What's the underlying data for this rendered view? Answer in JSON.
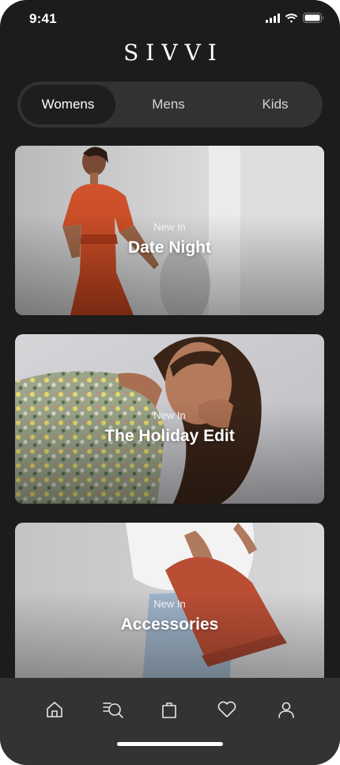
{
  "status_bar": {
    "time": "9:41"
  },
  "brand": {
    "name": "SIVVI"
  },
  "segments": [
    {
      "label": "Womens",
      "selected": true
    },
    {
      "label": "Mens",
      "selected": false
    },
    {
      "label": "Kids",
      "selected": false
    }
  ],
  "cards": [
    {
      "eyebrow": "New In",
      "title": "Date Night"
    },
    {
      "eyebrow": "New In",
      "title": "The Holiday Edit"
    },
    {
      "eyebrow": "New In",
      "title": "Accessories"
    }
  ],
  "bottom_nav": {
    "items": [
      {
        "icon": "home-icon"
      },
      {
        "icon": "search-list-icon"
      },
      {
        "icon": "shopping-bag-icon"
      },
      {
        "icon": "heart-icon"
      },
      {
        "icon": "profile-icon"
      }
    ]
  },
  "colors": {
    "background": "#1c1c1c",
    "segment_track": "#323232",
    "segment_active": "#1e1e1e",
    "nav_bar": "#333333",
    "text": "#ffffff"
  }
}
